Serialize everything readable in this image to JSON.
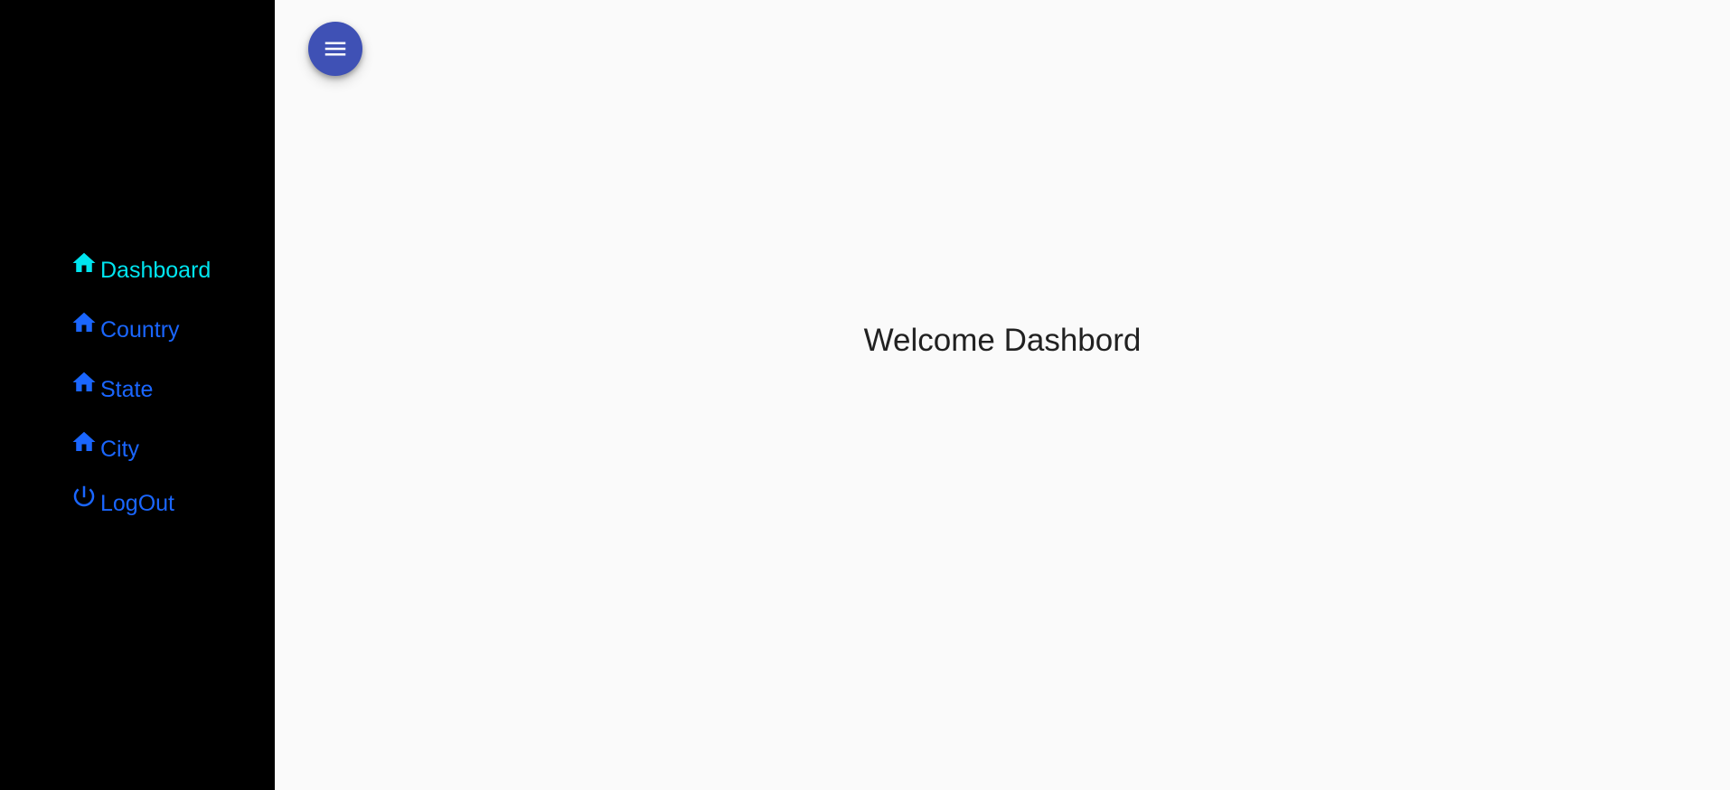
{
  "sidebar": {
    "background": "#000000",
    "items": [
      {
        "label": "Dashboard",
        "icon": "home-icon",
        "color": "#00e5f0",
        "active": true
      },
      {
        "label": "Country",
        "icon": "home-icon",
        "color": "#1a66ff",
        "active": false
      },
      {
        "label": "State",
        "icon": "home-icon",
        "color": "#1a66ff",
        "active": false
      },
      {
        "label": "City",
        "icon": "home-icon",
        "color": "#1a66ff",
        "active": false
      },
      {
        "label": "LogOut",
        "icon": "power-icon",
        "color": "#1a66ff",
        "active": false
      }
    ]
  },
  "header": {
    "menu_button": {
      "icon": "menu-icon",
      "color": "#3f51b5"
    }
  },
  "main": {
    "welcome_text": "Welcome Dashbord"
  }
}
